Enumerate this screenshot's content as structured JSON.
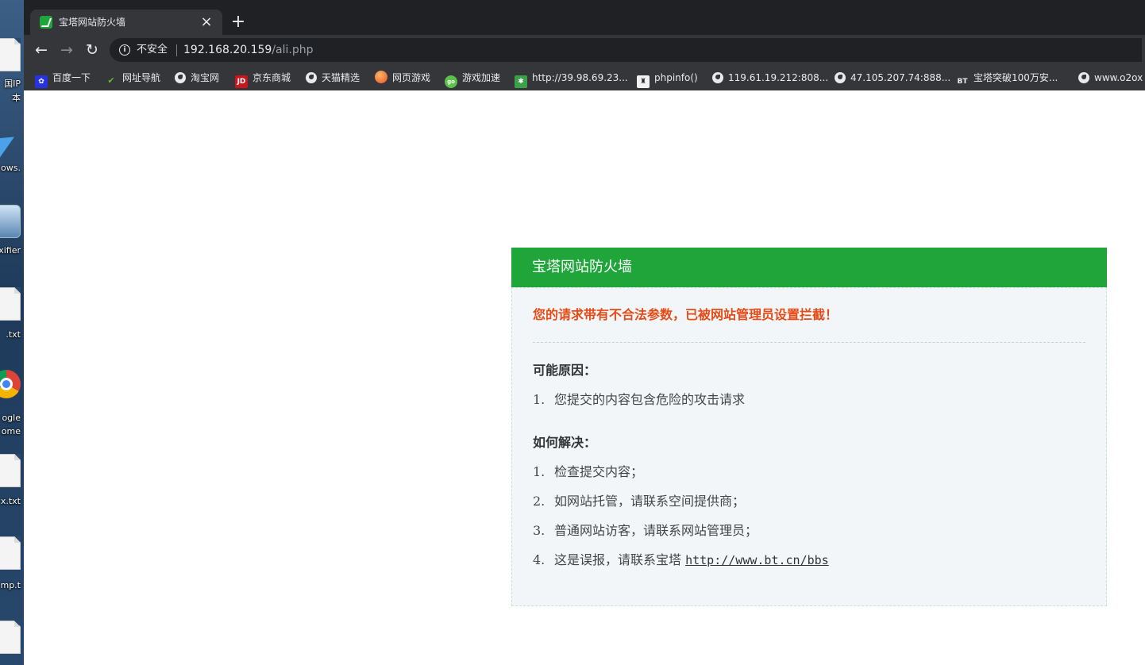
{
  "desktop": {
    "labels": [
      "国IP",
      "本",
      "ows.",
      "xifier",
      ".txt",
      "ogle",
      "ome",
      "x.txt",
      "mp.t"
    ]
  },
  "browser": {
    "tab": {
      "title": "宝塔网站防火墙",
      "close": "×"
    },
    "new_tab": "+",
    "nav": {
      "back": "←",
      "forward": "→",
      "reload": "↻"
    },
    "omnibox": {
      "security_label": "不安全",
      "url_host": "192.168.20.159",
      "url_path": "/ali.php"
    },
    "bookmarks": [
      {
        "label": "百度一下",
        "icon": "baidu-paw-icon"
      },
      {
        "label": "网址导航",
        "icon": "hao-icon"
      },
      {
        "label": "淘宝网",
        "icon": "globe-icon"
      },
      {
        "label": "京东商城",
        "icon": "jd-icon"
      },
      {
        "label": "天猫精选",
        "icon": "globe-icon"
      },
      {
        "label": "网页游戏",
        "icon": "balloon-icon"
      },
      {
        "label": "游戏加速",
        "icon": "game-accel-icon"
      },
      {
        "label": "http://39.98.69.23...",
        "icon": "star-icon"
      },
      {
        "label": "phpinfo()",
        "icon": "php-icon"
      },
      {
        "label": "119.61.19.212:808...",
        "icon": "globe-icon"
      },
      {
        "label": "47.105.207.74:888...",
        "icon": "globe-icon"
      },
      {
        "label": "宝塔突破100万安...",
        "icon": "bt-icon"
      },
      {
        "label": "www.o2ox",
        "icon": "globe-icon"
      }
    ]
  },
  "firewall": {
    "title": "宝塔网站防火墙",
    "alert": "您的请求带有不合法参数，已被网站管理员设置拦截！",
    "reasons_title": "可能原因：",
    "reasons": [
      {
        "num": "1.",
        "text": "您提交的内容包含危险的攻击请求"
      }
    ],
    "solutions_title": "如何解决：",
    "solutions": [
      {
        "num": "1.",
        "text": "检查提交内容；"
      },
      {
        "num": "2.",
        "text": "如网站托管，请联系空间提供商；"
      },
      {
        "num": "3.",
        "text": "普通网站访客，请联系网站管理员；"
      },
      {
        "num": "4.",
        "text": "这是误报，请联系宝塔 ",
        "link": "http://www.bt.cn/bbs"
      }
    ]
  },
  "colors": {
    "header_green": "#20a53a",
    "alert_red": "#e64b16",
    "body_bg": "#f3f6f9"
  }
}
